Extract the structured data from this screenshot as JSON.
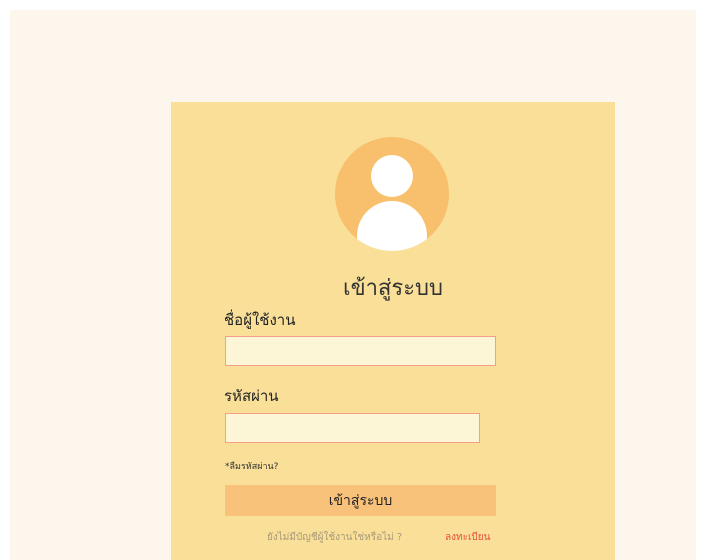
{
  "login_card": {
    "title": "เข้าสู่ระบบ",
    "username_label": "ชื่อผู้ใช้งาน",
    "username_value": "",
    "password_label": "รหัสผ่าน",
    "password_value": "",
    "forgot_password": "*ลืมรหัสผ่าน?",
    "login_button": "เข้าสู่ระบบ",
    "no_account_prompt": "ยังไม่มีบัญชีผู้ใช้งานใช่หรือไม่ ?",
    "register_link": "ลงทะเบียน"
  },
  "icons": {
    "avatar": "user-avatar-icon"
  },
  "colors": {
    "background": "#fdf6ec",
    "card": "#f9df98",
    "avatar": "#f8bf6c",
    "input_fill": "#fdf6d6",
    "input_border": "#f2a08a",
    "button": "#f8c27a",
    "register_link": "#e5523a"
  }
}
